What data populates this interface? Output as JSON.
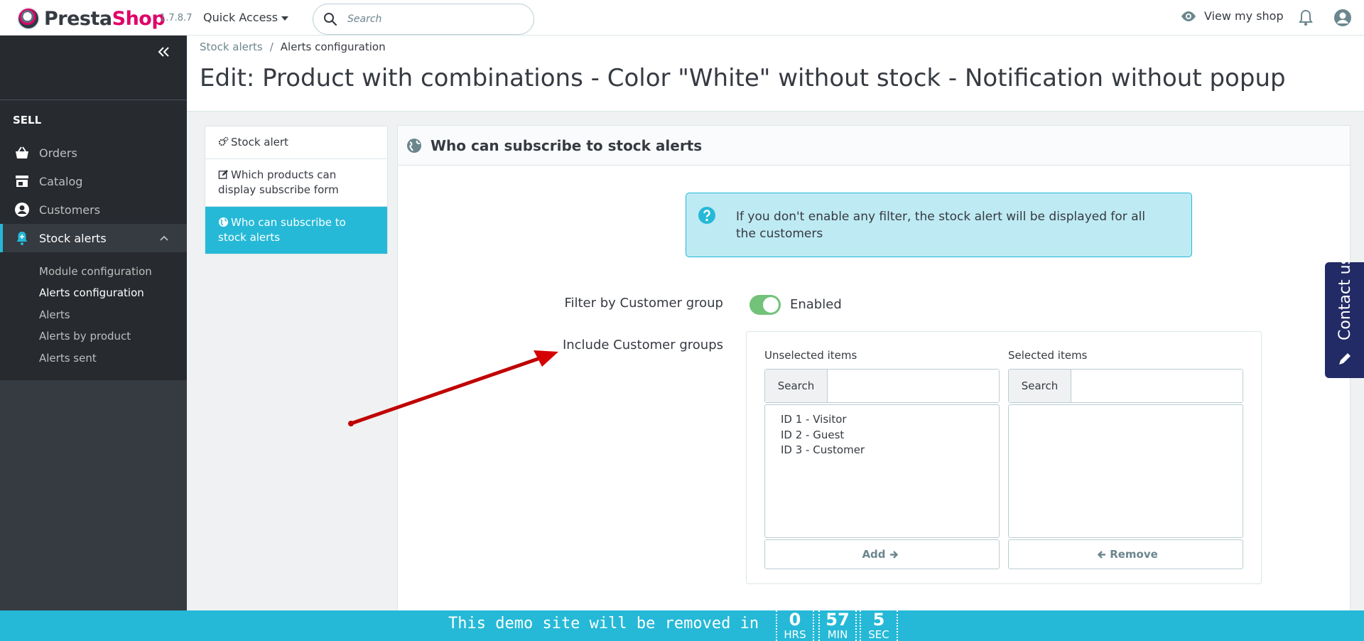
{
  "header": {
    "logo_text_left": "Presta",
    "logo_text_right": "Shop",
    "version": "1.7.8.7",
    "quick_access": "Quick Access",
    "search_placeholder": "Search",
    "view_shop": "View my shop"
  },
  "sidebar": {
    "section_title": "SELL",
    "items": [
      {
        "label": "Orders",
        "icon": "basket-icon"
      },
      {
        "label": "Catalog",
        "icon": "store-icon"
      },
      {
        "label": "Customers",
        "icon": "account-circle-icon"
      },
      {
        "label": "Stock alerts",
        "icon": "bell-plus-icon",
        "active": true
      }
    ],
    "subitems": [
      {
        "label": "Module configuration"
      },
      {
        "label": "Alerts configuration",
        "current": true
      },
      {
        "label": "Alerts"
      },
      {
        "label": "Alerts by product"
      },
      {
        "label": "Alerts sent"
      }
    ]
  },
  "breadcrumb": {
    "parent": "Stock alerts",
    "separator": "/",
    "current": "Alerts configuration"
  },
  "page_title": "Edit: Product with combinations - Color \"White\" without stock - Notification without popup",
  "tabs": [
    {
      "label": "Stock alert",
      "icon": "cogs-icon"
    },
    {
      "label": "Which products can display subscribe form",
      "icon": "edit-icon"
    },
    {
      "label": "Who can subscribe to stock alerts",
      "icon": "globe-icon",
      "active": true
    }
  ],
  "panel": {
    "heading": "Who can subscribe to stock alerts",
    "info": "If you don't enable any filter, the stock alert will be displayed for all the customers",
    "filter_label": "Filter by Customer group",
    "filter_state": "Enabled",
    "filter_enabled": true,
    "include_label": "Include Customer groups",
    "unselected_title": "Unselected items",
    "selected_title": "Selected items",
    "search_label": "Search",
    "unselected_items": [
      "ID 1 - Visitor",
      "ID 2 - Guest",
      "ID 3 - Customer"
    ],
    "selected_items": [],
    "add_label": "Add",
    "remove_label": "Remove"
  },
  "contact": {
    "label": "Contact us"
  },
  "demo": {
    "message": "This demo site will be removed in",
    "hours": "0",
    "hours_unit": "HRS",
    "minutes": "57",
    "minutes_unit": "MIN",
    "seconds": "5",
    "seconds_unit": "SEC"
  },
  "colors": {
    "accent": "#25b9d7",
    "brand_pink": "#df0067",
    "sidebar_dark": "#272a2f",
    "switch_on": "#72c279",
    "contact_bg": "#222b66",
    "annotation_arrow": "#d60000"
  }
}
